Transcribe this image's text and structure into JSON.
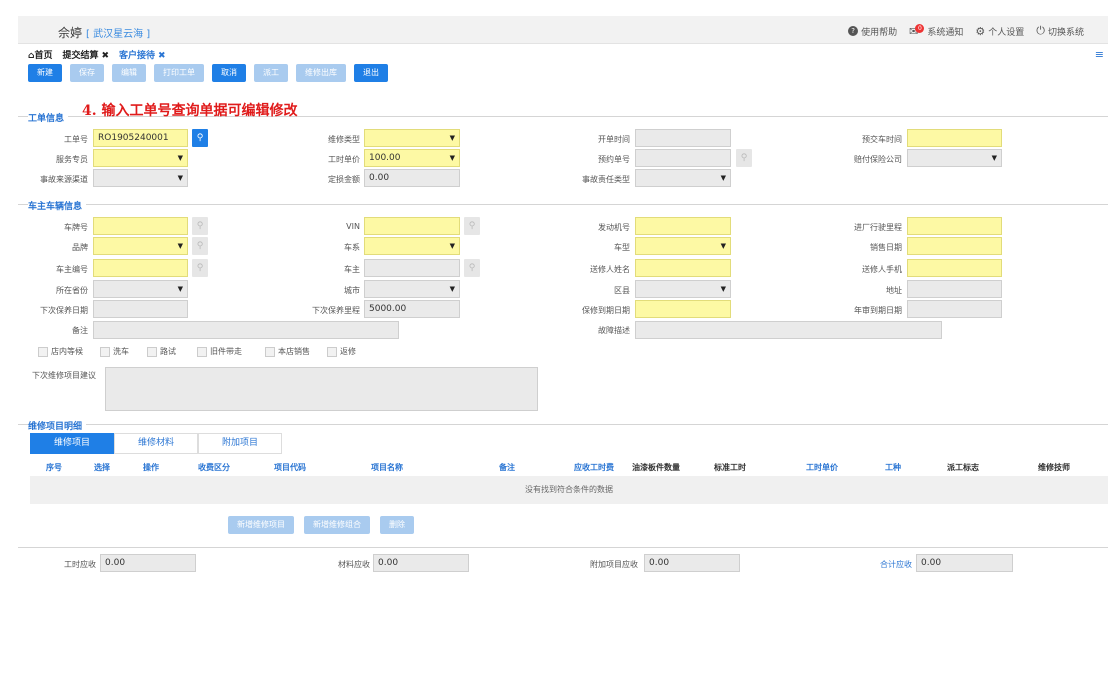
{
  "header": {
    "user": "佘婷",
    "store": "[ 武汉星云海 ]",
    "help": "使用帮助",
    "notify": "系统通知",
    "notify_badge": "0",
    "settings": "个人设置",
    "switch": "切换系统"
  },
  "tabs": [
    {
      "label": "首页"
    },
    {
      "label": "提交结算"
    },
    {
      "label": "客户接待"
    }
  ],
  "toolbar": [
    "新建",
    "保存",
    "编辑",
    "打印工单",
    "取消",
    "派工",
    "维修出库",
    "退出"
  ],
  "section1": {
    "title": "工单信息",
    "annotation": "4. 输入工单号查询单据可编辑修改"
  },
  "section2": {
    "title": "车主车辆信息"
  },
  "section3": {
    "title": "维修项目明细"
  },
  "fields": {
    "order_no_label": "工单号",
    "order_no": "RO1905240001",
    "repair_type_label": "维修类型",
    "open_time_label": "开单时间",
    "expect_time_label": "预交车时间",
    "advisor_label": "服务专员",
    "hour_price_label": "工时单价",
    "hour_price": "100.00",
    "appoint_no_label": "预约单号",
    "insurer_label": "赔付保险公司",
    "source_label": "事故来源渠道",
    "deposit_label": "定损金额",
    "deposit": "0.00",
    "liability_label": "事故责任类型",
    "plate_label": "车牌号",
    "vin_label": "VIN",
    "engine_label": "发动机号",
    "mileage_label": "进厂行驶里程",
    "brand_label": "品牌",
    "series_label": "车系",
    "model_label": "车型",
    "sale_date_label": "销售日期",
    "owner_no_label": "车主编号",
    "owner_label": "车主",
    "sender_label": "送修人姓名",
    "sender_phone_label": "送修人手机",
    "province_label": "所在省份",
    "city_label": "城市",
    "district_label": "区县",
    "address_label": "地址",
    "next_date_label": "下次保养日期",
    "next_mileage_label": "下次保养里程",
    "next_mileage": "5000.00",
    "warranty_label": "保修到期日期",
    "inspect_label": "年审到期日期",
    "remark_label": "备注",
    "fault_label": "故障描述",
    "advice_label": "下次维修项目建议"
  },
  "checkboxes": [
    "店内等候",
    "洗车",
    "路试",
    "旧件带走",
    "本店销售",
    "返修"
  ],
  "subtabs": [
    "维修项目",
    "维修材料",
    "附加项目"
  ],
  "table": {
    "columns": [
      "序号",
      "选择",
      "操作",
      "收费区分",
      "项目代码",
      "项目名称",
      "备注",
      "应收工时费",
      "油漆板件数量",
      "标准工时",
      "工时单价",
      "工种",
      "派工标志",
      "维修技师"
    ],
    "empty": "没有找到符合条件的数据",
    "buttons": [
      "新增维修项目",
      "新增维修组合",
      "删除"
    ]
  },
  "summary": {
    "labor_label": "工时应收",
    "labor": "0.00",
    "material_label": "材料应收",
    "material": "0.00",
    "extra_label": "附加项目应收",
    "extra": "0.00",
    "total_label": "合计应收",
    "total": "0.00"
  },
  "colors": {
    "accent": "#1f7fe6",
    "required": "#fdf9a4",
    "annotation": "#e01b1b"
  }
}
